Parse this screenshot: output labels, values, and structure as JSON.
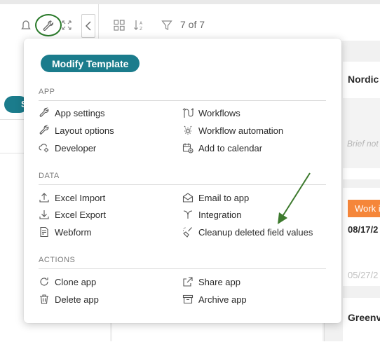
{
  "toolbar": {
    "record_count": "7 of 7"
  },
  "popup": {
    "modify_template_label": "Modify Template",
    "sections": {
      "app": {
        "heading": "APP",
        "items": [
          {
            "label": "App settings",
            "icon": "wrench-icon"
          },
          {
            "label": "Workflows",
            "icon": "workflow-icon"
          },
          {
            "label": "Layout options",
            "icon": "wrench-icon"
          },
          {
            "label": "Workflow automation",
            "icon": "gear-automation-icon"
          },
          {
            "label": "Developer",
            "icon": "developer-icon"
          },
          {
            "label": "Add to calendar",
            "icon": "calendar-add-icon"
          }
        ]
      },
      "data": {
        "heading": "DATA",
        "items": [
          {
            "label": "Excel Import",
            "icon": "upload-icon"
          },
          {
            "label": "Email to app",
            "icon": "envelope-icon"
          },
          {
            "label": "Excel Export",
            "icon": "download-icon"
          },
          {
            "label": "Integration",
            "icon": "integration-icon"
          },
          {
            "label": "Webform",
            "icon": "webform-icon"
          },
          {
            "label": "Cleanup deleted field values",
            "icon": "broom-icon"
          }
        ]
      },
      "actions": {
        "heading": "ACTIONS",
        "items": [
          {
            "label": "Clone app",
            "icon": "clone-icon"
          },
          {
            "label": "Share app",
            "icon": "share-icon"
          },
          {
            "label": "Delete app",
            "icon": "trash-icon"
          },
          {
            "label": "Archive app",
            "icon": "archive-icon"
          }
        ]
      }
    }
  },
  "background": {
    "card1_title": "Nordic",
    "card1_placeholder": "Brief not",
    "status_chip": "Work i",
    "date_primary": "08/17/2",
    "date_secondary": "05/27/2",
    "card2_title": "Greenv",
    "left_pill_text": "S"
  },
  "colors": {
    "accent_teal": "#1b7c8c",
    "status_orange": "#f5863a",
    "annotation_green": "#2a7a2a"
  }
}
